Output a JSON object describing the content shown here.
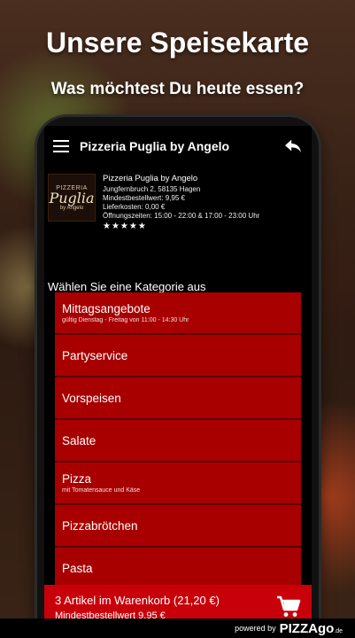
{
  "promo": {
    "headline": "Unsere Speisekarte",
    "subline": "Was möchtest Du heute essen?"
  },
  "appbar": {
    "title": "Pizzeria Puglia by Angelo",
    "menu_icon": "hamburger-icon",
    "back_icon": "back-arrow-icon"
  },
  "restaurant": {
    "logo": {
      "line1": "PIZZERIA",
      "line2": "Puglia",
      "line3": "by Angelo"
    },
    "name": "Pizzeria Puglia by Angelo",
    "address": "Jungfernbruch 2, 58135 Hagen",
    "min_order": "Mindestbestellwert: 9,95 €",
    "delivery_cost": "Lieferkosten: 0,00 €",
    "opening_hours": "Öffnungszeiten: 15:00 - 22:00 & 17:00 - 23:00 Uhr",
    "rating": "★★★★★",
    "rating_value": 5
  },
  "prompt": "Wählen Sie eine Kategorie aus",
  "categories": [
    {
      "title": "Mittagsangebote",
      "subtitle": "gültig Dienstag - Freitag von 11:00 - 14:30 Uhr"
    },
    {
      "title": "Partyservice",
      "subtitle": ""
    },
    {
      "title": "Vorspeisen",
      "subtitle": ""
    },
    {
      "title": "Salate",
      "subtitle": ""
    },
    {
      "title": "Pizza",
      "subtitle": "mit Tomatensauce und Käse"
    },
    {
      "title": "Pizzabrötchen",
      "subtitle": ""
    },
    {
      "title": "Pasta",
      "subtitle": ""
    }
  ],
  "cart": {
    "summary": "3 Artikel im Warenkorb (21,20 €)",
    "min_order": "Mindestbestellwert 9,95 €",
    "icon": "shopping-cart-icon"
  },
  "footer": {
    "powered_by": "powered by",
    "brand_prefix": "go",
    "brand_main": "PIZZAgo",
    "brand_suffix": ".de"
  },
  "colors": {
    "category_red": "#a80000",
    "cart_red": "#c8000a",
    "background": "#000000"
  }
}
